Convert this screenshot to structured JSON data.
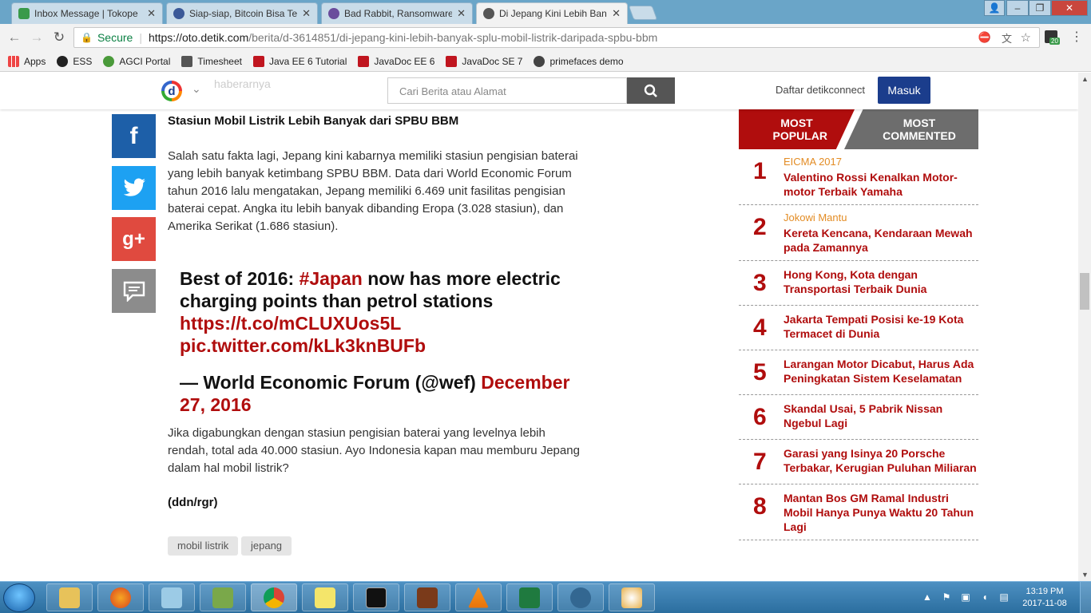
{
  "browser": {
    "tabs": [
      {
        "title": "Inbox Message | Tokope",
        "color": "#3a9a4a"
      },
      {
        "title": "Siap-siap, Bitcoin Bisa Te",
        "color": "#3b5998"
      },
      {
        "title": "Bad Rabbit, Ransomware",
        "color": "#6a4c9c"
      },
      {
        "title": "Di Jepang Kini Lebih Ban",
        "color": "#555555"
      }
    ],
    "secure_label": "Secure",
    "url_host": "https://oto.detik.com",
    "url_path": "/berita/d-3614851/di-jepang-kini-lebih-banyak-splu-mobil-listrik-daripada-spbu-bbm",
    "extension_badge": "20",
    "bookmarks": [
      "Apps",
      "ESS",
      "AGCI Portal",
      "Timesheet",
      "Java EE 6 Tutorial",
      "JavaDoc EE 6",
      "JavaDoc SE 7",
      "primefaces demo"
    ]
  },
  "site": {
    "logo_letter": "d",
    "ghost_text": "haberarnya",
    "search_placeholder": "Cari Berita atau Alamat",
    "daftar": "Daftar detikconnect",
    "masuk": "Masuk"
  },
  "article": {
    "heading": "Stasiun Mobil Listrik Lebih Banyak dari SPBU BBM",
    "para1": "Salah satu fakta lagi, Jepang kini kabarnya memiliki stasiun pengisian baterai yang lebih banyak ketimbang SPBU BBM. Data dari World Economic Forum tahun 2016 lalu mengatakan, Jepang memiliki 6.469 unit fasilitas pengisian baterai cepat. Angka itu lebih banyak dibanding Eropa (3.028 stasiun), dan Amerika Serikat (1.686 stasiun).",
    "tweet_pre": "Best of 2016: ",
    "tweet_hashtag": "#Japan",
    "tweet_mid": " now has more electric charging points than petrol stations ",
    "tweet_link1": "https://t.co/mCLUXUos5L",
    "tweet_link2": "pic.twitter.com/kLk3knBUFb",
    "tweet_author": "— World Economic Forum (@wef) ",
    "tweet_date": "December 27, 2016",
    "para2": "Jika digabungkan dengan stasiun pengisian baterai yang levelnya lebih rendah, total ada 40.000 stasiun. Ayo Indonesia kapan mau memburu Jepang dalam hal mobil listrik?",
    "credit": "(ddn/rgr)",
    "tags": [
      "mobil listrik",
      "jepang"
    ]
  },
  "sidebar": {
    "tab_popular": "MOST POPULAR",
    "tab_commented": "MOST COMMENTED",
    "items": [
      {
        "num": "1",
        "kw": "EICMA 2017",
        "title": "Valentino Rossi Kenalkan Motor-motor Terbaik Yamaha"
      },
      {
        "num": "2",
        "kw": "Jokowi Mantu",
        "title": "Kereta Kencana, Kendaraan Mewah pada Zamannya"
      },
      {
        "num": "3",
        "kw": "",
        "title": "Hong Kong, Kota dengan Transportasi Terbaik Dunia"
      },
      {
        "num": "4",
        "kw": "",
        "title": "Jakarta Tempati Posisi ke-19 Kota Termacet di Dunia"
      },
      {
        "num": "5",
        "kw": "",
        "title": "Larangan Motor Dicabut, Harus Ada Peningkatan Sistem Keselamatan"
      },
      {
        "num": "6",
        "kw": "",
        "title": "Skandal Usai, 5 Pabrik Nissan Ngebul Lagi"
      },
      {
        "num": "7",
        "kw": "",
        "title": "Garasi yang Isinya 20 Porsche Terbakar, Kerugian Puluhan Miliaran"
      },
      {
        "num": "8",
        "kw": "",
        "title": "Mantan Bos GM Ramal Industri Mobil Hanya Punya Waktu 20 Tahun Lagi"
      }
    ]
  },
  "taskbar": {
    "time": "13:19 PM",
    "date": "2017-11-08"
  },
  "colors": {
    "accent_red": "#b00d0d",
    "detik_blue": "#1b3d8c",
    "facebook": "#1d5fa8",
    "twitter": "#1da1f2",
    "gplus": "#e04a3f"
  }
}
